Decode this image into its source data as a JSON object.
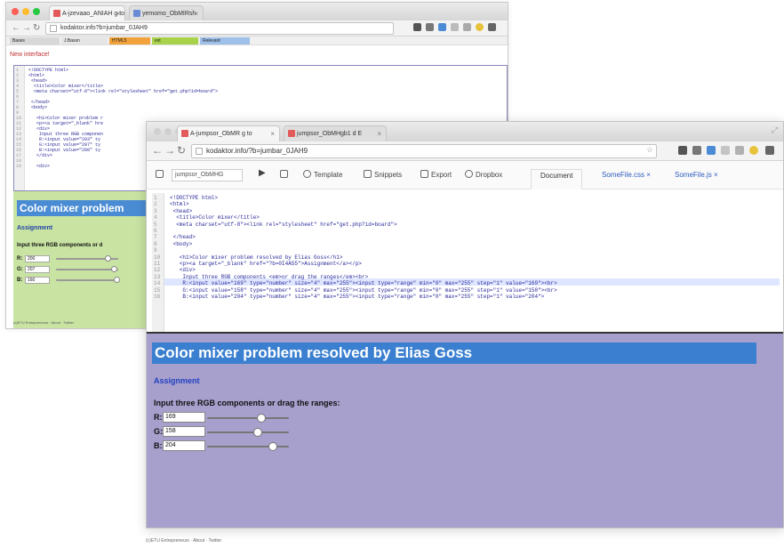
{
  "back_window": {
    "tabs": [
      "A-jzevaao_ANIAH g to",
      "yemomo_ObMIRsh"
    ],
    "url": "kodaktor.info?b=jumbar_0JAH9",
    "bookmarks": [
      "Bases",
      "J.Bassn",
      "HTML5",
      "ext",
      "Relevant"
    ],
    "banner_text": "New interface!",
    "code_lines": [
      "<!DOCTYPE html>",
      "<html>",
      " <head>",
      "  <title>Color mixer</title>",
      "  <meta charset=\"utf-8\"><link rel=\"stylesheet\" href=\"get.php?id=board\">",
      "",
      " </head>",
      " <body>",
      "",
      "   <h1>Color mixer problem r",
      "   <p><a target=\"_blank\" hre",
      "   <div>",
      "    Input three RGB componen",
      "    R:<input value=\"203\" ty",
      "    G:<input value=\"207\" ty",
      "    B:<input value=\"200\" ty",
      "   </div>",
      "",
      "   <div>"
    ],
    "preview": {
      "heading": "Color mixer problem",
      "assignment": "Assignment",
      "input_line": "Input three RGB components or d",
      "rows": [
        {
          "label": "R:",
          "value": "200",
          "level": 0.83
        },
        {
          "label": "G:",
          "value": "207",
          "level": 0.93
        },
        {
          "label": "B:",
          "value": "160",
          "level": 0.98
        }
      ]
    },
    "footer": "(c)ETU Entrepreneurs · About · Twitter"
  },
  "front_window": {
    "tabs": [
      "A-jumpsor_ObMR g to",
      "jumpsor_ObMHgb1 d E"
    ],
    "url": "kodaktor.info/?b=jumbar_0JAH9",
    "toolbar": {
      "name_value": "jumpsor_ObMHG",
      "template_label": "Template",
      "snippets_label": "Snippets",
      "export_label": "Export",
      "dropbox_label": "Dropbox"
    },
    "doc_tabs": [
      "Document",
      "SomeFile.css ×",
      "SomeFile.js ×"
    ],
    "code_lines": [
      "<!DOCTYPE html>",
      "<html>",
      " <head>",
      "  <title>Color mixer</title>",
      "  <meta charset=\"utf-8\"><link rel=\"stylesheet\" href=\"get.php?id=board\">",
      "",
      " </head>",
      " <body>",
      "",
      "   <h1>Color mixer problem resolved by Elias Goss</h1>",
      "   <p><a target=\"_blank\" href=\"?b=0I4A55\">Assignment</a></p>",
      "   <div>",
      "    Input three RGB components <em>or drag the ranges</em><br>",
      "    R:<input value=\"169\" type=\"number\" size=\"4\" max=\"255\"><input type=\"range\" min=\"0\" max=\"255\" step=\"1\" value=\"169\"><br>",
      "    G:<input value=\"158\" type=\"number\" size=\"4\" max=\"255\"><input type=\"range\" min=\"0\" max=\"255\" step=\"1\" value=\"158\"><br>",
      "    B:<input value=\"204\" type=\"number\" size=\"4\" max=\"255\"><input type=\"range\" min=\"0\" max=\"255\" step=\"1\" value=\"204\">"
    ],
    "preview": {
      "heading": "Color mixer problem resolved by Elias Goss",
      "assignment": "Assignment",
      "input_line": "Input three RGB components or drag the ranges:",
      "rows": [
        {
          "label": "R:",
          "value": "169",
          "level": 0.66
        },
        {
          "label": "G:",
          "value": "158",
          "level": 0.62
        },
        {
          "label": "B:",
          "value": "204",
          "level": 0.8
        }
      ]
    },
    "footer": "(c)ETU Entrepreneurs · About · Twitter"
  },
  "colors": {
    "back_preview_bg": "#c8e3a2",
    "front_preview_bg": "#a79fcc",
    "heading_bg": "#3a7fd0",
    "link": "#2242c0"
  }
}
